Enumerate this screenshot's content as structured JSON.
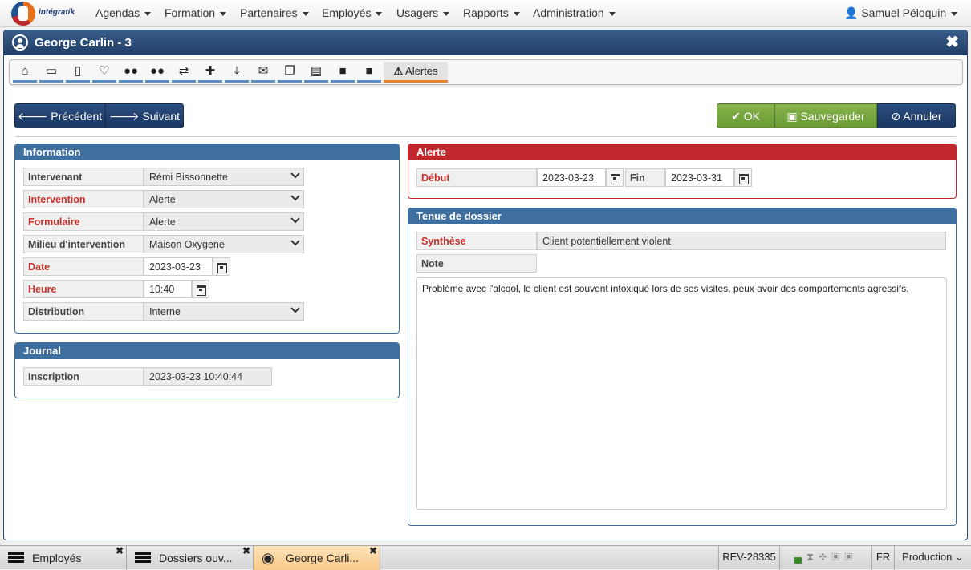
{
  "app": {
    "logo_text": "intégratik",
    "user": "Samuel Péloquin"
  },
  "menu": [
    "Agendas",
    "Formation",
    "Partenaires",
    "Employés",
    "Usagers",
    "Rapports",
    "Administration"
  ],
  "window": {
    "title": "George Carlin - 3",
    "close": "✖"
  },
  "toolbar": {
    "active_tab": "Alertes"
  },
  "actions": {
    "prev": "Précédent",
    "next": "Suivant",
    "ok": "OK",
    "save": "Sauvegarder",
    "cancel": "Annuler"
  },
  "information": {
    "title": "Information",
    "fields": [
      {
        "label": "Intervenant",
        "value": "Rémi Bissonnette"
      },
      {
        "label": "Intervention",
        "value": "Alerte"
      },
      {
        "label": "Formulaire",
        "value": "Alerte"
      },
      {
        "label": "Milieu d'intervention",
        "value": "Maison Oxygene"
      },
      {
        "label": "Date",
        "value": "2023-03-23"
      },
      {
        "label": "Heure",
        "value": "10:40"
      },
      {
        "label": "Distribution",
        "value": "Interne"
      }
    ]
  },
  "journal": {
    "title": "Journal",
    "label": "Inscription",
    "value": "2023-03-23 10:40:44"
  },
  "alerte": {
    "title": "Alerte",
    "debut_label": "Début",
    "debut": "2023-03-23",
    "fin_label": "Fin",
    "fin": "2023-03-31"
  },
  "dossier": {
    "title": "Tenue de dossier",
    "synthese_label": "Synthèse",
    "synthese": "Client potentiellement violent",
    "note_label": "Note",
    "note": "Problème avec l'alcool, le client est souvent intoxiqué lors de ses visites, peux avoir des comportements agressifs."
  },
  "taskbar": {
    "tabs": [
      "Employés",
      "Dossiers ouv...",
      "George Carli..."
    ],
    "rev": "REV-28335",
    "lang": "FR",
    "env": "Production"
  }
}
